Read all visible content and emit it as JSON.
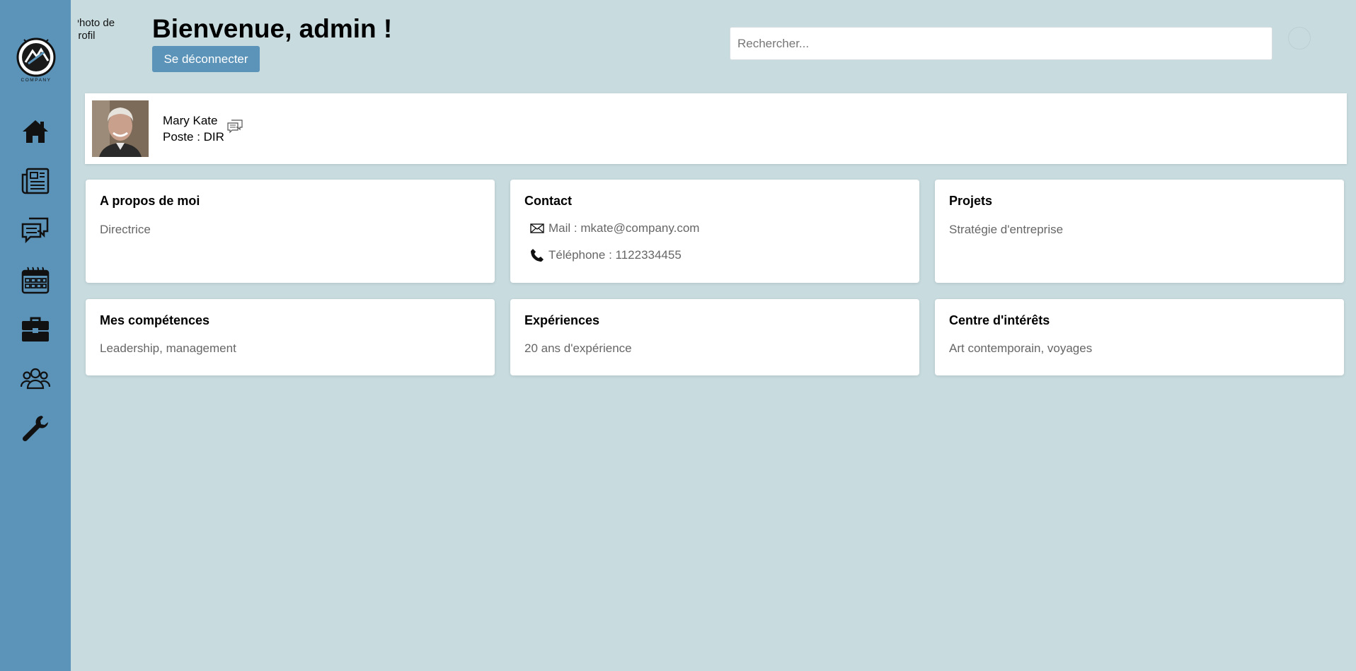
{
  "sidebar": {
    "logo": {
      "text": "COMPANY"
    },
    "items": [
      {
        "icon": "home-icon",
        "label": "Accueil"
      },
      {
        "icon": "newspaper-icon",
        "label": "Actualités"
      },
      {
        "icon": "chat-icon",
        "label": "Messagerie"
      },
      {
        "icon": "calendar-icon",
        "label": "Calendrier"
      },
      {
        "icon": "briefcase-icon",
        "label": "Projets"
      },
      {
        "icon": "users-icon",
        "label": "Équipe"
      },
      {
        "icon": "wrench-icon",
        "label": "Paramètres"
      }
    ],
    "color": "#5b93b9"
  },
  "header": {
    "avatar_alt_line1": "Photo de",
    "avatar_alt_line2": "profil",
    "welcome": "Bienvenue, admin !",
    "logout_label": "Se déconnecter",
    "search_placeholder": "Rechercher..."
  },
  "profile": {
    "name": "Mary Kate",
    "role": "Poste : DIR",
    "message_icon": "message-icon"
  },
  "cards": {
    "about": {
      "title": "A propos de moi",
      "value": "Directrice"
    },
    "contact": {
      "title": "Contact",
      "mail": "Mail : mkate@company.com",
      "phone": "Téléphone : 1122334455"
    },
    "projects": {
      "title": "Projets",
      "value": "Stratégie d'entreprise"
    },
    "skills": {
      "title": "Mes compétences",
      "value": "Leadership, management"
    },
    "experience": {
      "title": "Expériences",
      "value": "20 ans d'expérience"
    },
    "interests": {
      "title": "Centre d'intérêts",
      "value": "Art contemporain, voyages"
    }
  },
  "colors": {
    "background": "#c8dce0",
    "accent": "#5b93b9",
    "card": "#ffffff"
  }
}
